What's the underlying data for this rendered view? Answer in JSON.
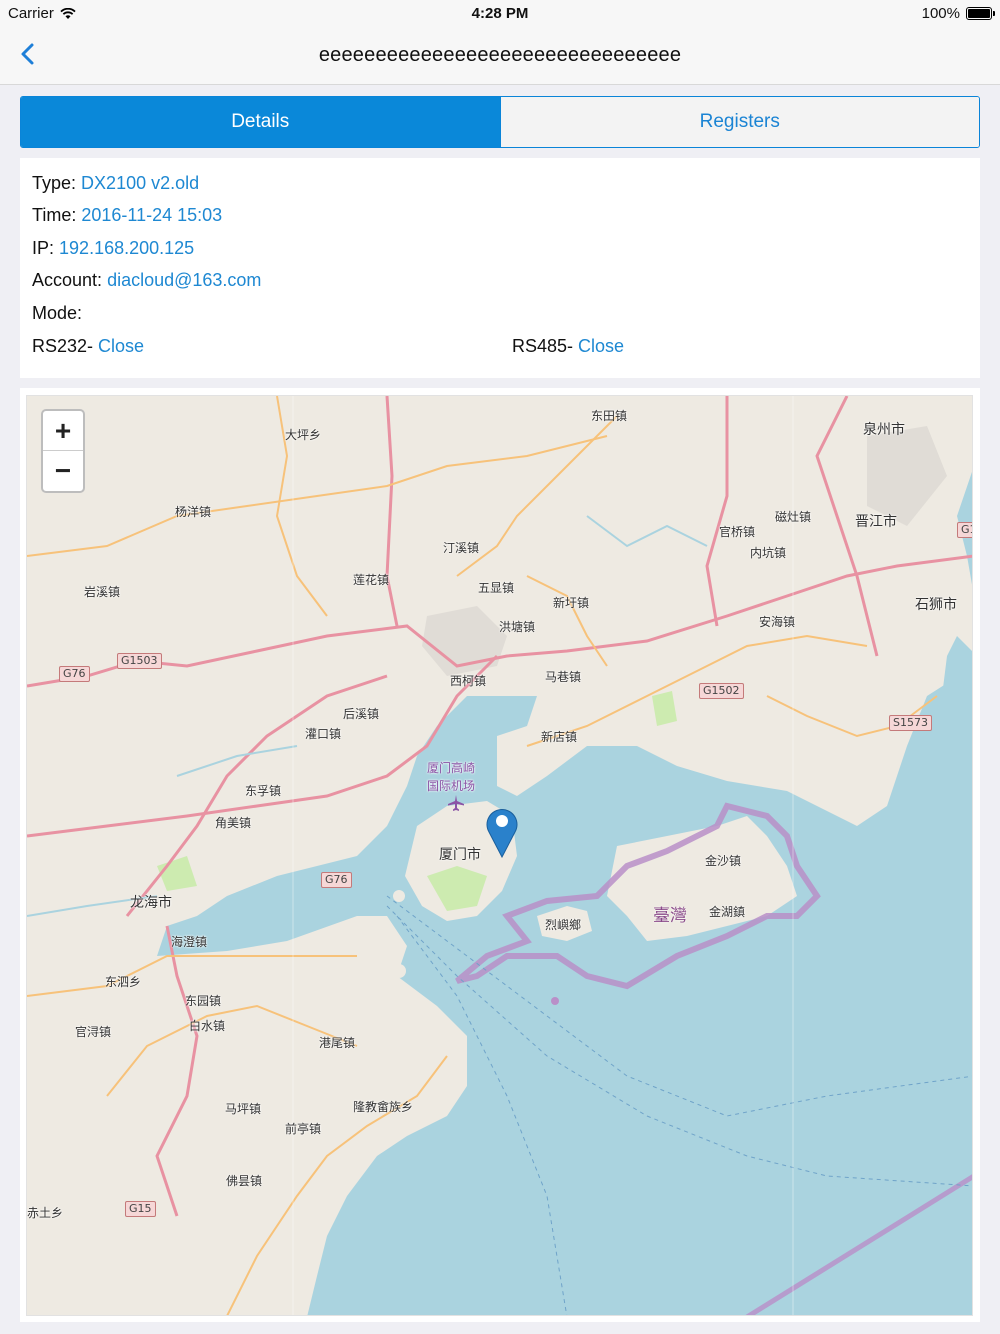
{
  "status_bar": {
    "carrier": "Carrier",
    "time": "4:28 PM",
    "battery": "100%"
  },
  "nav": {
    "title": "eeeeeeeeeeeeeeeeeeeeeeeeeeeeeeee"
  },
  "tabs": [
    {
      "label": "Details",
      "active": true
    },
    {
      "label": "Registers",
      "active": false
    }
  ],
  "details": {
    "type_label": "Type:",
    "type_value": "DX2100 v2.old",
    "time_label": "Time:",
    "time_value": "2016-11-24 15:03",
    "ip_label": "IP:",
    "ip_value": "192.168.200.125",
    "account_label": "Account:",
    "account_value": "diacloud@163.com",
    "mode_label": "Mode:",
    "rs232_label": "RS232-",
    "rs232_value": "Close",
    "rs485_label": "RS485-",
    "rs485_value": "Close"
  },
  "map": {
    "zoom_in": "+",
    "zoom_out": "−",
    "labels": {
      "dongtian": "东田镇",
      "quanzhou": "泉州市",
      "dapingxiang": "大坪乡",
      "yangyang": "杨洋镇",
      "tingxi": "汀溪镇",
      "cilin": "磁灶镇",
      "jinjiang": "晋江市",
      "guanqiao": "官桥镇",
      "neikeng": "内坑镇",
      "yanxi": "岩溪镇",
      "lianhua": "莲花镇",
      "wuxian": "五显镇",
      "xinxu": "新圩镇",
      "shishi": "石狮市",
      "anhai": "安海镇",
      "hongtang": "洪塘镇",
      "xike": "西柯镇",
      "maxiang": "马巷镇",
      "houxi": "后溪镇",
      "guankou": "灌口镇",
      "xindian": "新店镇",
      "airport1": "厦门高崎",
      "airport2": "国际机场",
      "dongfu": "东孚镇",
      "jiaomei": "角美镇",
      "xiamen": "厦门市",
      "jinsha": "金沙镇",
      "longhai": "龙海市",
      "lieyu": "烈嶼鄉",
      "taiwan": "臺灣",
      "jinhu": "金湖鎮",
      "haicheng": "海澄镇",
      "dongsi": "东泗乡",
      "dongyuan": "东园镇",
      "baishui": "白水镇",
      "guanxun": "官浔镇",
      "gangwei": "港尾镇",
      "maping": "马坪镇",
      "longjiao": "隆教畲族乡",
      "qianting": "前亭镇",
      "fotan": "佛昙镇",
      "chitu": "赤土乡"
    },
    "shields": {
      "g76_a": "G76",
      "g1503": "G1503",
      "g1502": "G1502",
      "s1573": "S1573",
      "g76_b": "G76",
      "g15": "G15",
      "g1_edge": "G1"
    }
  },
  "colors": {
    "accent": "#0a88d9",
    "link": "#1e88d2",
    "water": "#aad3df",
    "land": "#eeeae2",
    "border": "#b98fc8"
  }
}
